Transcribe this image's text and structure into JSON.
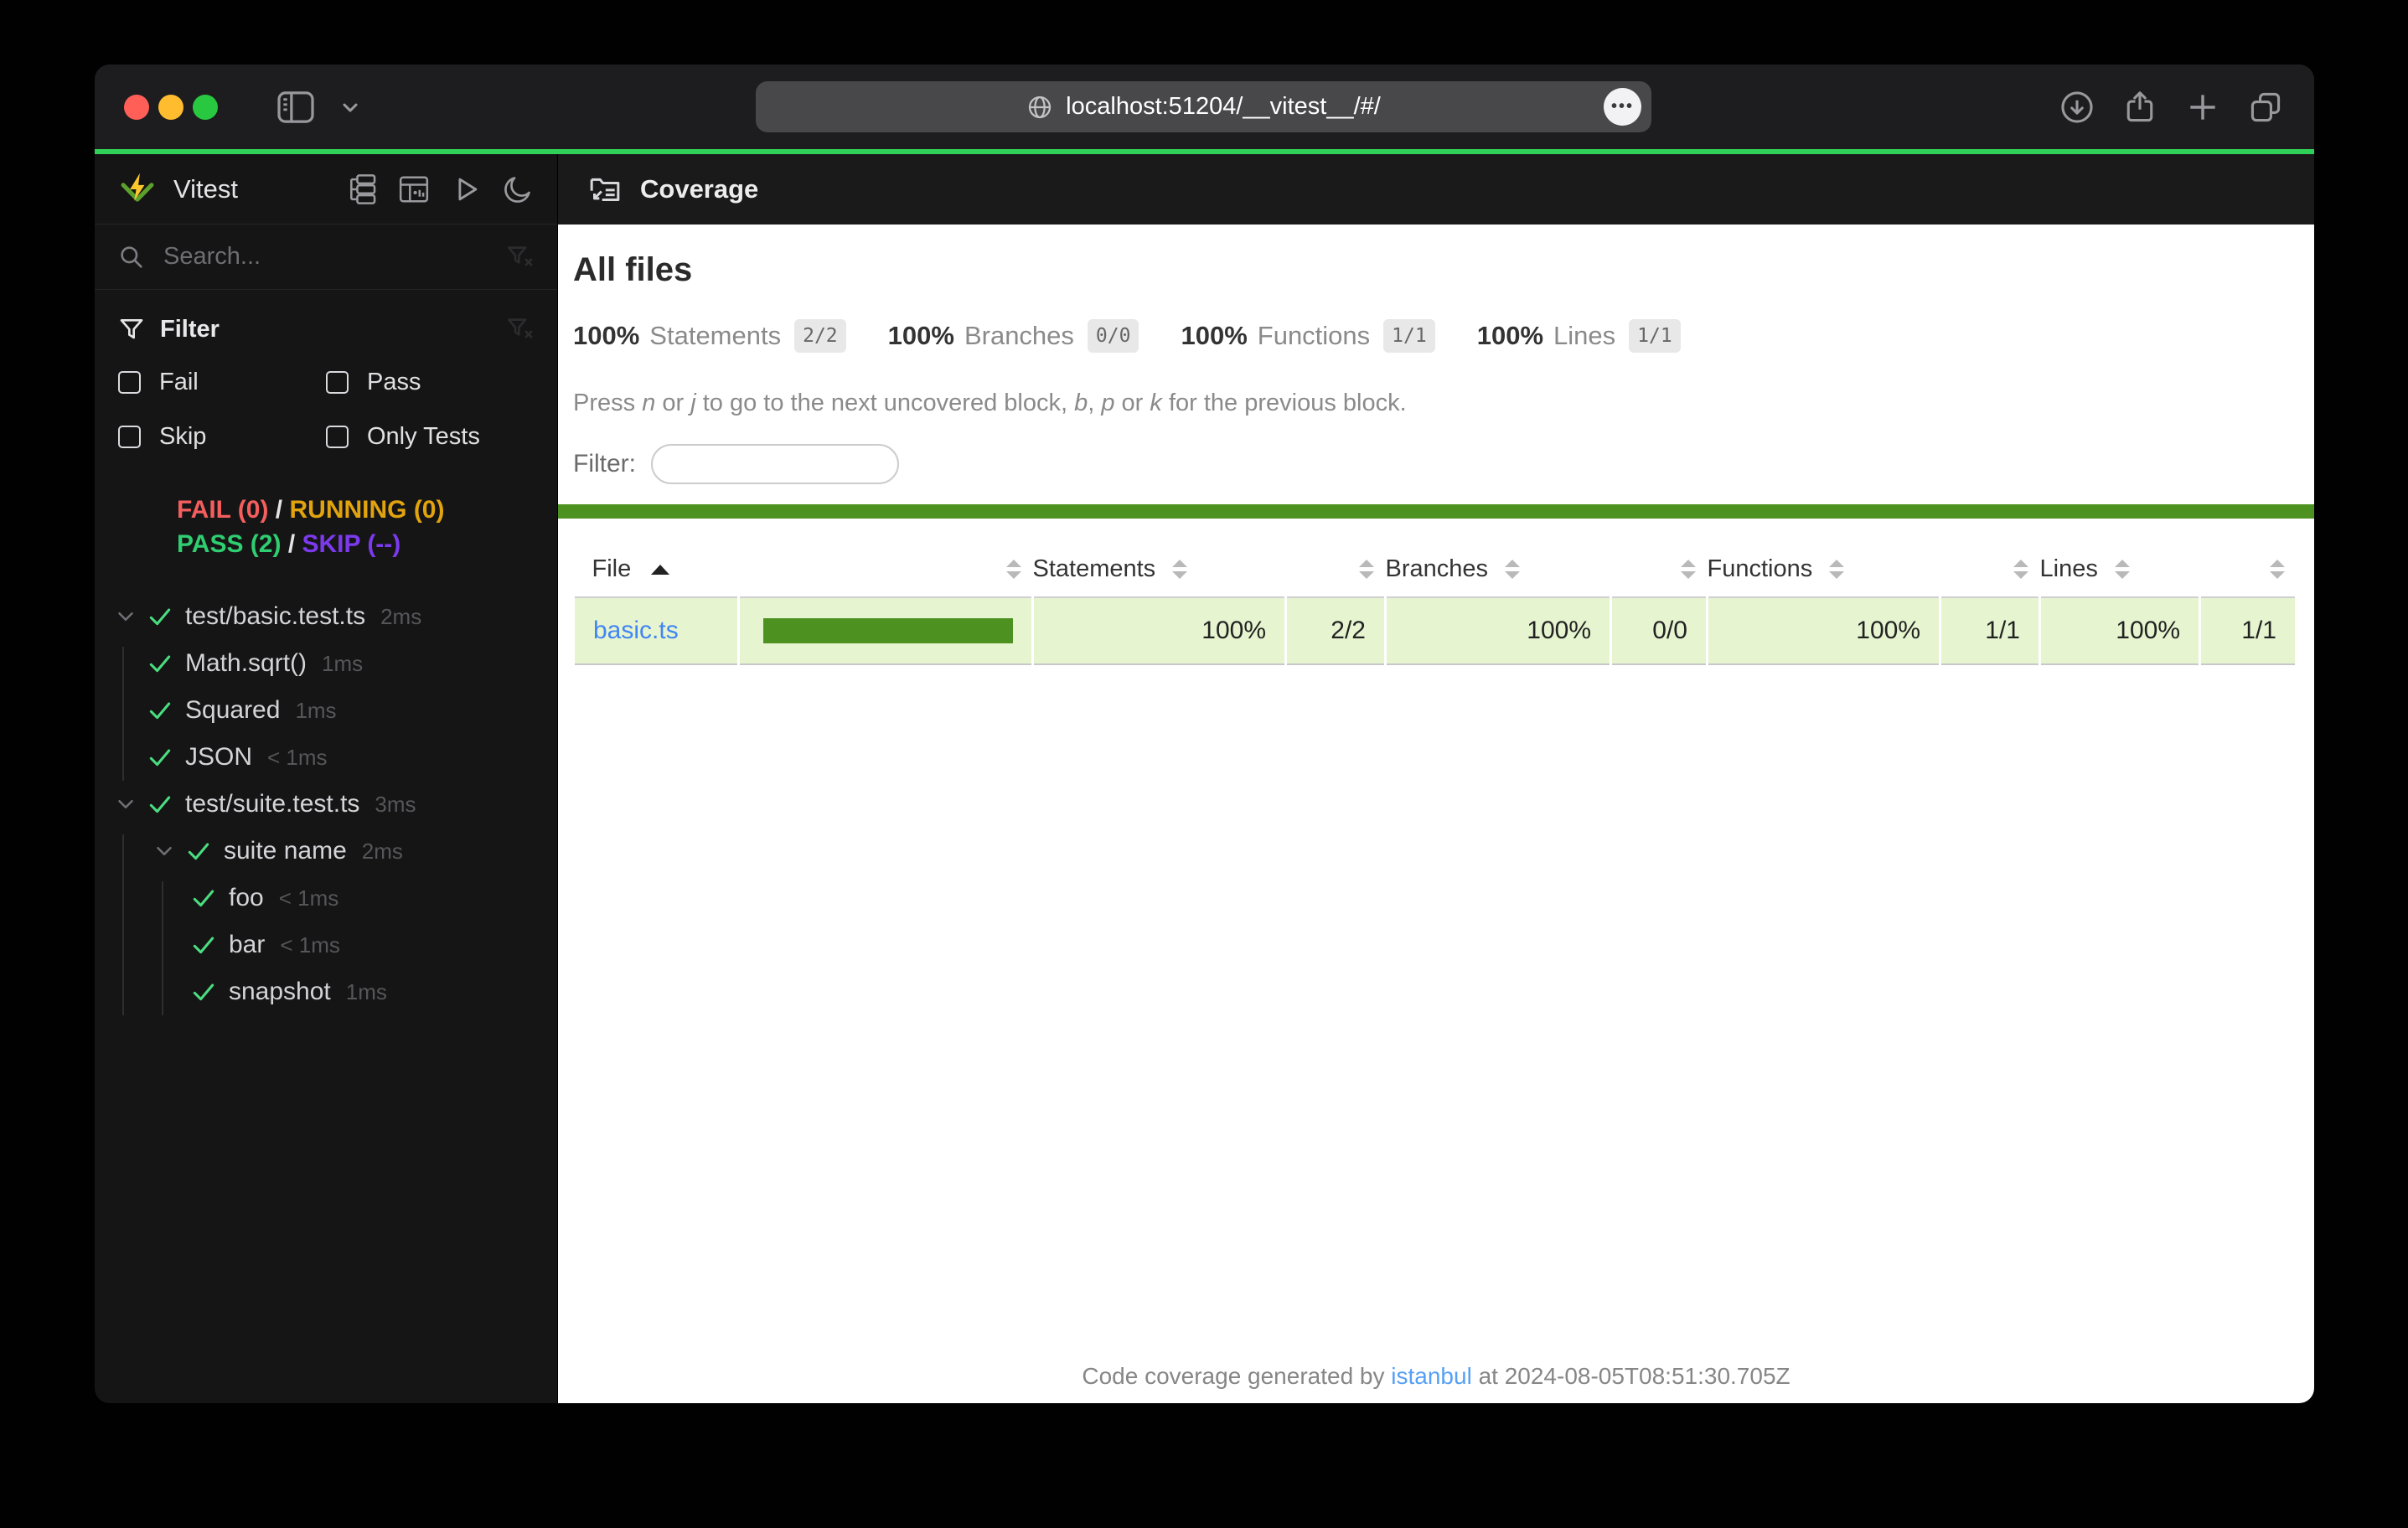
{
  "browser": {
    "url": "localhost:51204/__vitest__/#/",
    "ellipsis": "•••"
  },
  "sidebar": {
    "app_name": "Vitest",
    "search_placeholder": "Search...",
    "filter": {
      "title": "Filter",
      "options": {
        "fail": "Fail",
        "pass": "Pass",
        "skip": "Skip",
        "only_tests": "Only Tests"
      }
    },
    "status": {
      "fail": "FAIL (0)",
      "running": "RUNNING (0)",
      "pass": "PASS (2)",
      "skip": "SKIP (--)",
      "separator": "/"
    },
    "tree": [
      {
        "label": "test/basic.test.ts",
        "time": "2ms"
      },
      {
        "label": "Math.sqrt()",
        "time": "1ms"
      },
      {
        "label": "Squared",
        "time": "1ms"
      },
      {
        "label": "JSON",
        "time": "< 1ms"
      },
      {
        "label": "test/suite.test.ts",
        "time": "3ms"
      },
      {
        "label": "suite name",
        "time": "2ms"
      },
      {
        "label": "foo",
        "time": "< 1ms"
      },
      {
        "label": "bar",
        "time": "< 1ms"
      },
      {
        "label": "snapshot",
        "time": "1ms"
      }
    ]
  },
  "coverage": {
    "nav_title": "Coverage",
    "heading": "All files",
    "summary": [
      {
        "pct": "100%",
        "label": "Statements",
        "fraction": "2/2"
      },
      {
        "pct": "100%",
        "label": "Branches",
        "fraction": "0/0"
      },
      {
        "pct": "100%",
        "label": "Functions",
        "fraction": "1/1"
      },
      {
        "pct": "100%",
        "label": "Lines",
        "fraction": "1/1"
      }
    ],
    "hint_parts": [
      "Press ",
      "n",
      " or ",
      "j",
      " to go to the next uncovered block, ",
      "b",
      ", ",
      "p",
      " or ",
      "k",
      " for the previous block."
    ],
    "filter_label": "Filter:",
    "table": {
      "columns": {
        "file": "File",
        "statements": "Statements",
        "branches": "Branches",
        "functions": "Functions",
        "lines": "Lines"
      },
      "rows": [
        {
          "file": "basic.ts",
          "bar_pct": 100,
          "statements_pct": "100%",
          "statements_raw": "2/2",
          "branches_pct": "100%",
          "branches_raw": "0/0",
          "functions_pct": "100%",
          "functions_raw": "1/1",
          "lines_pct": "100%",
          "lines_raw": "1/1"
        }
      ]
    },
    "footer": {
      "prefix": "Code coverage generated by ",
      "tool": "istanbul",
      "suffix": " at 2024-08-05T08:51:30.705Z"
    }
  },
  "colors": {
    "accent": "#2fd158",
    "tl-red": "#ff5f57",
    "tl-yellow": "#febc2e",
    "tl-green": "#28c840",
    "fail": "#f45e5e",
    "running": "#e2a40e",
    "pass": "#2fce71",
    "skip": "#7c3aed",
    "cover-green": "#4d9221",
    "cover-bg": "#e6f5d0",
    "link": "#4285f4",
    "footer-link": "#56a0f5"
  }
}
